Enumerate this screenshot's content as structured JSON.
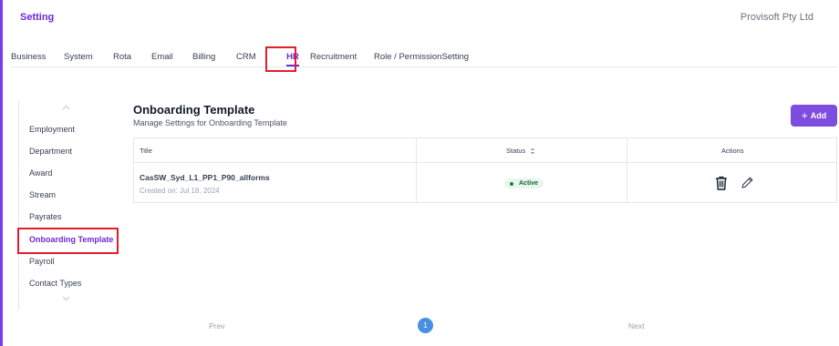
{
  "header": {
    "title": "Setting",
    "company": "Provisoft Pty Ltd"
  },
  "tabs": [
    {
      "label": "Business"
    },
    {
      "label": "System"
    },
    {
      "label": "Rota"
    },
    {
      "label": "Email"
    },
    {
      "label": "Billing"
    },
    {
      "label": "CRM"
    },
    {
      "label": "HR",
      "active": true
    },
    {
      "label": "Recruitment"
    },
    {
      "label": "Role / PermissionSetting"
    }
  ],
  "sidebar": {
    "items": [
      {
        "label": "Employment"
      },
      {
        "label": "Department"
      },
      {
        "label": "Award"
      },
      {
        "label": "Stream"
      },
      {
        "label": "Payrates"
      },
      {
        "label": "Onboarding Template",
        "active": true
      },
      {
        "label": "Payroll"
      },
      {
        "label": "Contact Types"
      }
    ]
  },
  "main": {
    "title": "Onboarding Template",
    "subtitle": "Manage Settings for Onboarding Template",
    "add_label": "Add"
  },
  "table": {
    "headers": {
      "title": "Title",
      "status": "Status",
      "actions": "Actions"
    },
    "rows": [
      {
        "name": "CasSW_Syd_L1_PP1_P90_allforms",
        "created": "Created on: Jul 18, 2024",
        "status": "Active"
      }
    ]
  },
  "pagination": {
    "prev": "Prev",
    "page": "1",
    "next": "Next"
  },
  "colors": {
    "accent": "#7c3aed",
    "highlight": "#e11d2e",
    "status_active": "#15803d",
    "page_active": "#4a90e2"
  },
  "icons": [
    "chevron-up-icon",
    "chevron-down-icon",
    "plus-icon",
    "sort-icon",
    "trash-icon",
    "pencil-icon"
  ]
}
